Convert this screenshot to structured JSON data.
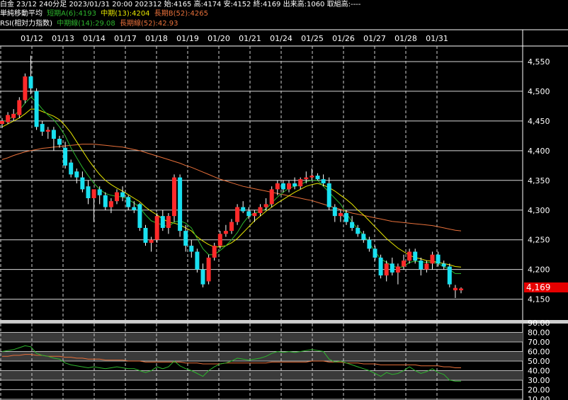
{
  "header": {
    "line1": "白金 23/12 240分足 2023/01/31 20:00 202312 始:4165 高:4174 安:4152 終:4169 出来高:1060 取組高:----",
    "ma_label": "単純移動平均",
    "ma_short": "短期A(6):4193",
    "ma_mid": "中期(13):4204",
    "ma_long": "長期B(52):4265",
    "rsi_label": "RSI(相対力指数)",
    "rsi_mid": "中期線(14):29.08",
    "rsi_long": "長期線(52):42.93"
  },
  "colors": {
    "up": "#ff2a2a",
    "down": "#19e0f0",
    "ma_short": "#2db52d",
    "ma_mid": "#e6e600",
    "ma_long": "#e8703a",
    "rsi_mid": "#2db52d",
    "rsi_long": "#e8703a",
    "last_price_bg": "#e60000"
  },
  "last_price": "4,169",
  "chart_data": {
    "type": "candlestick",
    "x_tick_labels": [
      "01/12",
      "01/13",
      "01/14",
      "01/17",
      "01/18",
      "01/19",
      "01/20",
      "01/21",
      "01/24",
      "01/25",
      "01/26",
      "01/27",
      "01/28",
      "01/31"
    ],
    "price_axis": {
      "ylim": [
        4115,
        4575
      ],
      "ticks": [
        4550,
        4500,
        4450,
        4400,
        4350,
        4300,
        4250,
        4200,
        4150
      ]
    },
    "rsi_axis": {
      "ylim": [
        10,
        90
      ],
      "ticks": [
        90,
        80,
        70,
        60,
        50,
        40,
        30,
        20,
        10
      ]
    },
    "candles": [
      {
        "o": 4445,
        "h": 4455,
        "l": 4438,
        "c": 4450
      },
      {
        "o": 4448,
        "h": 4465,
        "l": 4445,
        "c": 4460
      },
      {
        "o": 4455,
        "h": 4470,
        "l": 4450,
        "c": 4462
      },
      {
        "o": 4460,
        "h": 4490,
        "l": 4455,
        "c": 4485
      },
      {
        "o": 4485,
        "h": 4530,
        "l": 4480,
        "c": 4525
      },
      {
        "o": 4525,
        "h": 4560,
        "l": 4495,
        "c": 4505
      },
      {
        "o": 4500,
        "h": 4505,
        "l": 4435,
        "c": 4440
      },
      {
        "o": 4445,
        "h": 4450,
        "l": 4425,
        "c": 4432
      },
      {
        "o": 4432,
        "h": 4440,
        "l": 4420,
        "c": 4435
      },
      {
        "o": 4435,
        "h": 4440,
        "l": 4400,
        "c": 4420
      },
      {
        "o": 4420,
        "h": 4425,
        "l": 4405,
        "c": 4410
      },
      {
        "o": 4405,
        "h": 4415,
        "l": 4370,
        "c": 4375
      },
      {
        "o": 4380,
        "h": 4385,
        "l": 4355,
        "c": 4360
      },
      {
        "o": 4365,
        "h": 4370,
        "l": 4345,
        "c": 4355
      },
      {
        "o": 4355,
        "h": 4365,
        "l": 4330,
        "c": 4335
      },
      {
        "o": 4340,
        "h": 4350,
        "l": 4310,
        "c": 4320
      },
      {
        "o": 4320,
        "h": 4325,
        "l": 4280,
        "c": 4335
      },
      {
        "o": 4335,
        "h": 4340,
        "l": 4310,
        "c": 4325
      },
      {
        "o": 4325,
        "h": 4330,
        "l": 4300,
        "c": 4305
      },
      {
        "o": 4305,
        "h": 4320,
        "l": 4295,
        "c": 4315
      },
      {
        "o": 4315,
        "h": 4335,
        "l": 4310,
        "c": 4330
      },
      {
        "o": 4330,
        "h": 4340,
        "l": 4315,
        "c": 4322
      },
      {
        "o": 4322,
        "h": 4325,
        "l": 4300,
        "c": 4305
      },
      {
        "o": 4305,
        "h": 4315,
        "l": 4295,
        "c": 4300
      },
      {
        "o": 4310,
        "h": 4312,
        "l": 4265,
        "c": 4270
      },
      {
        "o": 4270,
        "h": 4275,
        "l": 4240,
        "c": 4245
      },
      {
        "o": 4245,
        "h": 4255,
        "l": 4230,
        "c": 4250
      },
      {
        "o": 4250,
        "h": 4295,
        "l": 4245,
        "c": 4290
      },
      {
        "o": 4290,
        "h": 4300,
        "l": 4265,
        "c": 4270
      },
      {
        "o": 4270,
        "h": 4295,
        "l": 4260,
        "c": 4290
      },
      {
        "o": 4290,
        "h": 4360,
        "l": 4280,
        "c": 4355
      },
      {
        "o": 4355,
        "h": 4360,
        "l": 4255,
        "c": 4265
      },
      {
        "o": 4265,
        "h": 4275,
        "l": 4230,
        "c": 4240
      },
      {
        "o": 4240,
        "h": 4250,
        "l": 4220,
        "c": 4230
      },
      {
        "o": 4230,
        "h": 4235,
        "l": 4195,
        "c": 4200
      },
      {
        "o": 4200,
        "h": 4210,
        "l": 4170,
        "c": 4175
      },
      {
        "o": 4180,
        "h": 4225,
        "l": 4175,
        "c": 4220
      },
      {
        "o": 4220,
        "h": 4245,
        "l": 4215,
        "c": 4240
      },
      {
        "o": 4240,
        "h": 4265,
        "l": 4235,
        "c": 4260
      },
      {
        "o": 4260,
        "h": 4275,
        "l": 4255,
        "c": 4265
      },
      {
        "o": 4265,
        "h": 4285,
        "l": 4260,
        "c": 4280
      },
      {
        "o": 4280,
        "h": 4310,
        "l": 4275,
        "c": 4305
      },
      {
        "o": 4305,
        "h": 4315,
        "l": 4295,
        "c": 4298
      },
      {
        "o": 4298,
        "h": 4305,
        "l": 4285,
        "c": 4290
      },
      {
        "o": 4290,
        "h": 4300,
        "l": 4280,
        "c": 4295
      },
      {
        "o": 4295,
        "h": 4310,
        "l": 4290,
        "c": 4305
      },
      {
        "o": 4305,
        "h": 4320,
        "l": 4300,
        "c": 4310
      },
      {
        "o": 4310,
        "h": 4340,
        "l": 4305,
        "c": 4335
      },
      {
        "o": 4335,
        "h": 4350,
        "l": 4325,
        "c": 4345
      },
      {
        "o": 4345,
        "h": 4350,
        "l": 4330,
        "c": 4335
      },
      {
        "o": 4335,
        "h": 4350,
        "l": 4330,
        "c": 4345
      },
      {
        "o": 4345,
        "h": 4355,
        "l": 4335,
        "c": 4340
      },
      {
        "o": 4340,
        "h": 4355,
        "l": 4335,
        "c": 4352
      },
      {
        "o": 4352,
        "h": 4365,
        "l": 4345,
        "c": 4355
      },
      {
        "o": 4355,
        "h": 4370,
        "l": 4350,
        "c": 4358
      },
      {
        "o": 4358,
        "h": 4362,
        "l": 4350,
        "c": 4352
      },
      {
        "o": 4352,
        "h": 4360,
        "l": 4340,
        "c": 4345
      },
      {
        "o": 4345,
        "h": 4355,
        "l": 4300,
        "c": 4305
      },
      {
        "o": 4305,
        "h": 4310,
        "l": 4280,
        "c": 4290
      },
      {
        "o": 4290,
        "h": 4300,
        "l": 4280,
        "c": 4295
      },
      {
        "o": 4295,
        "h": 4300,
        "l": 4275,
        "c": 4280
      },
      {
        "o": 4280,
        "h": 4290,
        "l": 4265,
        "c": 4270
      },
      {
        "o": 4270,
        "h": 4275,
        "l": 4255,
        "c": 4260
      },
      {
        "o": 4260,
        "h": 4265,
        "l": 4245,
        "c": 4250
      },
      {
        "o": 4250,
        "h": 4255,
        "l": 4230,
        "c": 4235
      },
      {
        "o": 4235,
        "h": 4240,
        "l": 4215,
        "c": 4220
      },
      {
        "o": 4220,
        "h": 4225,
        "l": 4185,
        "c": 4190
      },
      {
        "o": 4190,
        "h": 4215,
        "l": 4180,
        "c": 4210
      },
      {
        "o": 4210,
        "h": 4220,
        "l": 4190,
        "c": 4195
      },
      {
        "o": 4195,
        "h": 4210,
        "l": 4175,
        "c": 4205
      },
      {
        "o": 4205,
        "h": 4225,
        "l": 4200,
        "c": 4215
      },
      {
        "o": 4215,
        "h": 4235,
        "l": 4210,
        "c": 4230
      },
      {
        "o": 4230,
        "h": 4235,
        "l": 4210,
        "c": 4215
      },
      {
        "o": 4215,
        "h": 4220,
        "l": 4190,
        "c": 4200
      },
      {
        "o": 4200,
        "h": 4215,
        "l": 4195,
        "c": 4210
      },
      {
        "o": 4210,
        "h": 4230,
        "l": 4200,
        "c": 4225
      },
      {
        "o": 4225,
        "h": 4230,
        "l": 4205,
        "c": 4210
      },
      {
        "o": 4210,
        "h": 4215,
        "l": 4200,
        "c": 4205
      },
      {
        "o": 4205,
        "h": 4210,
        "l": 4170,
        "c": 4175
      },
      {
        "o": 4165,
        "h": 4174,
        "l": 4152,
        "c": 4169
      },
      {
        "o": 4165,
        "h": 4170,
        "l": 4160,
        "c": 4168
      }
    ],
    "ma_short": [
      4448,
      4452,
      4458,
      4468,
      4480,
      4490,
      4482,
      4470,
      4460,
      4452,
      4440,
      4425,
      4405,
      4388,
      4372,
      4358,
      4345,
      4335,
      4328,
      4325,
      4323,
      4322,
      4318,
      4312,
      4304,
      4292,
      4282,
      4278,
      4275,
      4272,
      4280,
      4282,
      4278,
      4270,
      4252,
      4235,
      4225,
      4225,
      4232,
      4240,
      4250,
      4262,
      4278,
      4290,
      4295,
      4298,
      4302,
      4312,
      4322,
      4330,
      4337,
      4340,
      4343,
      4348,
      4350,
      4350,
      4340,
      4330,
      4320,
      4310,
      4295,
      4280,
      4268,
      4258,
      4245,
      4230,
      4218,
      4212,
      4206,
      4203,
      4205,
      4212,
      4214,
      4213,
      4212,
      4212,
      4210,
      4205,
      4200,
      4193,
      4193
    ],
    "ma_mid": [
      4440,
      4445,
      4450,
      4455,
      4462,
      4470,
      4470,
      4466,
      4462,
      4458,
      4452,
      4442,
      4430,
      4415,
      4400,
      4385,
      4372,
      4360,
      4350,
      4343,
      4337,
      4332,
      4326,
      4320,
      4314,
      4305,
      4298,
      4292,
      4285,
      4280,
      4278,
      4275,
      4270,
      4265,
      4255,
      4248,
      4242,
      4238,
      4238,
      4240,
      4245,
      4252,
      4262,
      4272,
      4282,
      4290,
      4298,
      4305,
      4312,
      4318,
      4324,
      4330,
      4335,
      4340,
      4343,
      4345,
      4342,
      4338,
      4332,
      4325,
      4318,
      4310,
      4300,
      4292,
      4282,
      4272,
      4262,
      4252,
      4244,
      4236,
      4230,
      4224,
      4220,
      4218,
      4215,
      4214,
      4212,
      4210,
      4208,
      4205,
      4204
    ],
    "ma_long": [
      4385,
      4388,
      4392,
      4395,
      4398,
      4400,
      4402,
      4404,
      4405,
      4406,
      4407,
      4408,
      4409,
      4410,
      4411,
      4411,
      4411,
      4410,
      4409,
      4408,
      4407,
      4406,
      4404,
      4402,
      4400,
      4397,
      4394,
      4391,
      4388,
      4385,
      4382,
      4379,
      4375,
      4372,
      4368,
      4364,
      4360,
      4356,
      4352,
      4349,
      4346,
      4343,
      4340,
      4338,
      4336,
      4334,
      4332,
      4330,
      4328,
      4326,
      4324,
      4322,
      4320,
      4318,
      4316,
      4313,
      4310,
      4307,
      4304,
      4301,
      4298,
      4295,
      4293,
      4291,
      4289,
      4287,
      4285,
      4283,
      4281,
      4280,
      4279,
      4278,
      4277,
      4276,
      4275,
      4274,
      4272,
      4270,
      4268,
      4266,
      4265
    ],
    "rsi_mid": [
      60,
      61,
      62,
      64,
      66,
      65,
      58,
      56,
      55,
      53,
      52,
      48,
      46,
      45,
      44,
      43,
      44,
      43,
      42,
      43,
      44,
      43,
      42,
      42,
      40,
      38,
      40,
      44,
      42,
      44,
      50,
      45,
      42,
      40,
      37,
      34,
      40,
      44,
      47,
      48,
      50,
      53,
      52,
      51,
      52,
      53,
      55,
      58,
      60,
      59,
      60,
      59,
      60,
      61,
      62,
      61,
      60,
      52,
      49,
      50,
      48,
      46,
      44,
      42,
      40,
      37,
      34,
      38,
      36,
      37,
      40,
      44,
      40,
      37,
      39,
      42,
      38,
      36,
      30,
      29,
      29
    ],
    "rsi_long": [
      55,
      55,
      56,
      56,
      57,
      57,
      56,
      56,
      55,
      55,
      55,
      54,
      54,
      53,
      53,
      52,
      52,
      52,
      51,
      51,
      51,
      51,
      50,
      50,
      50,
      49,
      49,
      49,
      49,
      49,
      49,
      49,
      48,
      48,
      48,
      47,
      47,
      47,
      47,
      48,
      48,
      48,
      48,
      48,
      48,
      48,
      48,
      49,
      49,
      49,
      49,
      49,
      49,
      49,
      50,
      50,
      50,
      49,
      49,
      49,
      48,
      48,
      48,
      47,
      47,
      47,
      46,
      46,
      46,
      46,
      46,
      46,
      46,
      45,
      45,
      45,
      45,
      44,
      44,
      43,
      43
    ]
  }
}
